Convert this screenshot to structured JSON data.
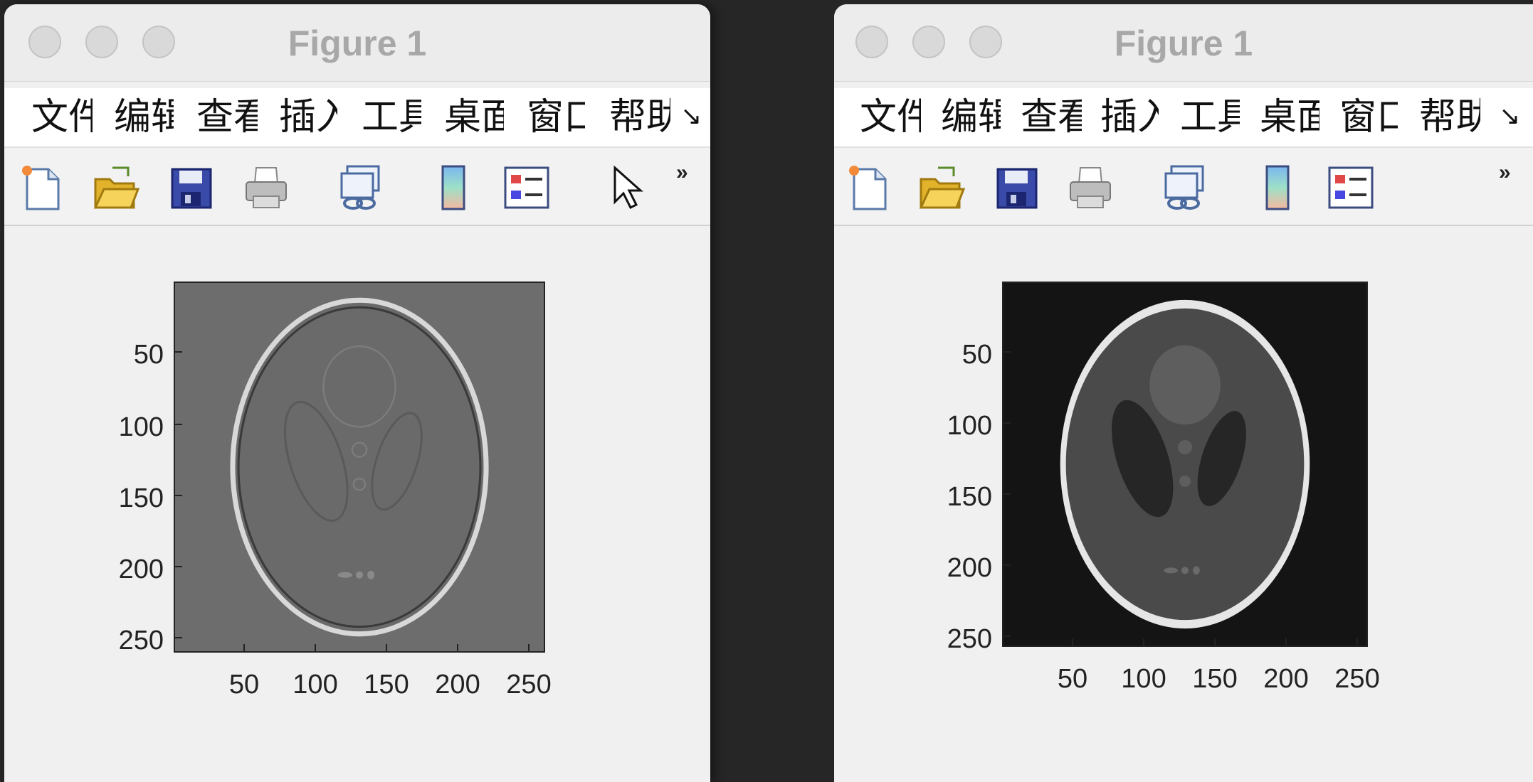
{
  "windows": [
    {
      "title": "Figure 1",
      "menu": [
        "文件",
        "编辑",
        "查看",
        "插入",
        "工具",
        "桌面",
        "窗口",
        "帮助"
      ],
      "menu_overflow": "↘",
      "toolbar": [
        "new-figure-icon",
        "open-folder-icon",
        "save-icon",
        "print-icon",
        "link-plot-icon",
        "colorbar-icon",
        "legend-icon",
        "pointer-icon"
      ],
      "toolbar_overflow": "»",
      "image": {
        "style": "filtered-edges-gray",
        "xticks": [
          "50",
          "100",
          "150",
          "200",
          "250"
        ],
        "yticks": [
          "50",
          "100",
          "150",
          "200",
          "250"
        ]
      }
    },
    {
      "title": "Figure 1",
      "menu": [
        "文件",
        "编辑",
        "查看",
        "插入",
        "工具",
        "桌面",
        "窗口",
        "帮助"
      ],
      "menu_overflow": "↘",
      "toolbar": [
        "new-figure-icon",
        "open-folder-icon",
        "save-icon",
        "print-icon",
        "link-plot-icon",
        "colorbar-icon",
        "legend-icon"
      ],
      "toolbar_overflow": "»",
      "image": {
        "style": "shepp-logan-phantom",
        "xticks": [
          "50",
          "100",
          "150",
          "200",
          "250"
        ],
        "yticks": [
          "50",
          "100",
          "150",
          "200",
          "250"
        ]
      }
    }
  ]
}
